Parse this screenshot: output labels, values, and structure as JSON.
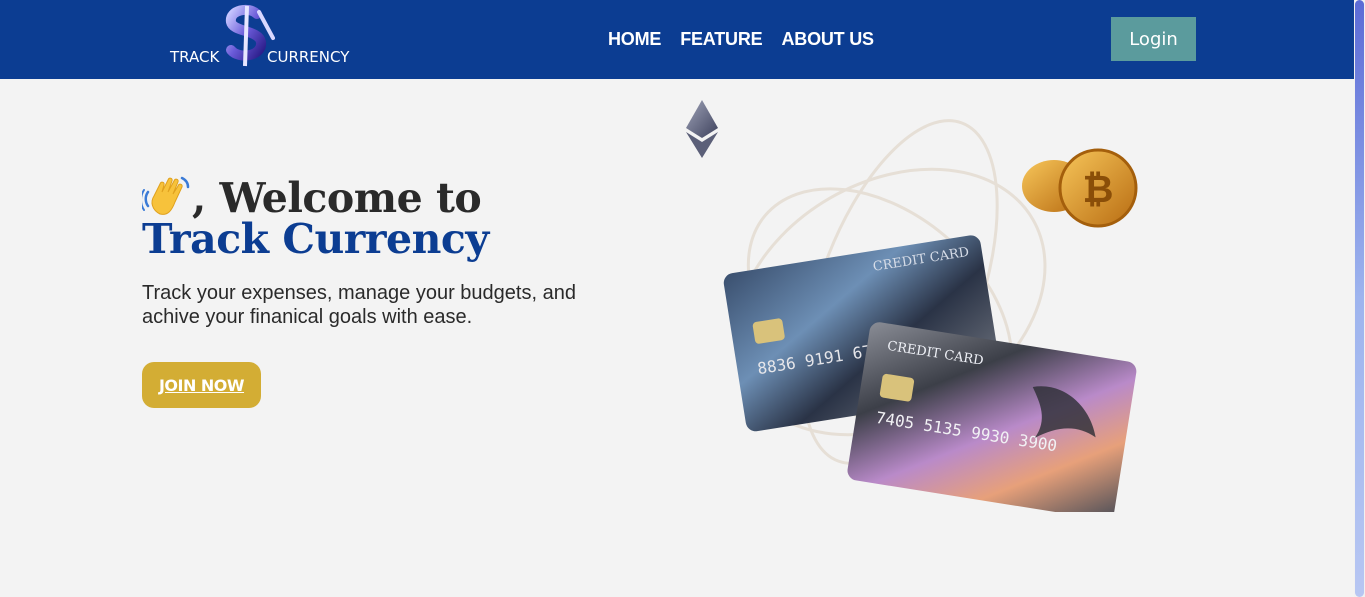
{
  "navbar": {
    "logo_left": "TRACK",
    "logo_right": "CURRENCY",
    "links": [
      "HOME",
      "FEATURE",
      "ABOUT US"
    ],
    "login_label": "Login"
  },
  "hero": {
    "welcome_text": ", Welcome to",
    "brand_text": "Track Currency",
    "tagline": "Track your expenses, manage your budgets, and achive your finanical goals with ease.",
    "join_label": "JOIN NOW"
  },
  "illustration": {
    "card_back_label": "CREDIT CARD",
    "card_front_label": "CREDIT CARD"
  },
  "colors": {
    "navbar": "#0c3d92",
    "login": "#5b9b9d",
    "join": "#d3ad34",
    "brand": "#0c3d92"
  },
  "icons": [
    "dollar-logo-icon",
    "waving-hand-icon",
    "ethereum-icon",
    "bitcoin-coins-icon"
  ]
}
